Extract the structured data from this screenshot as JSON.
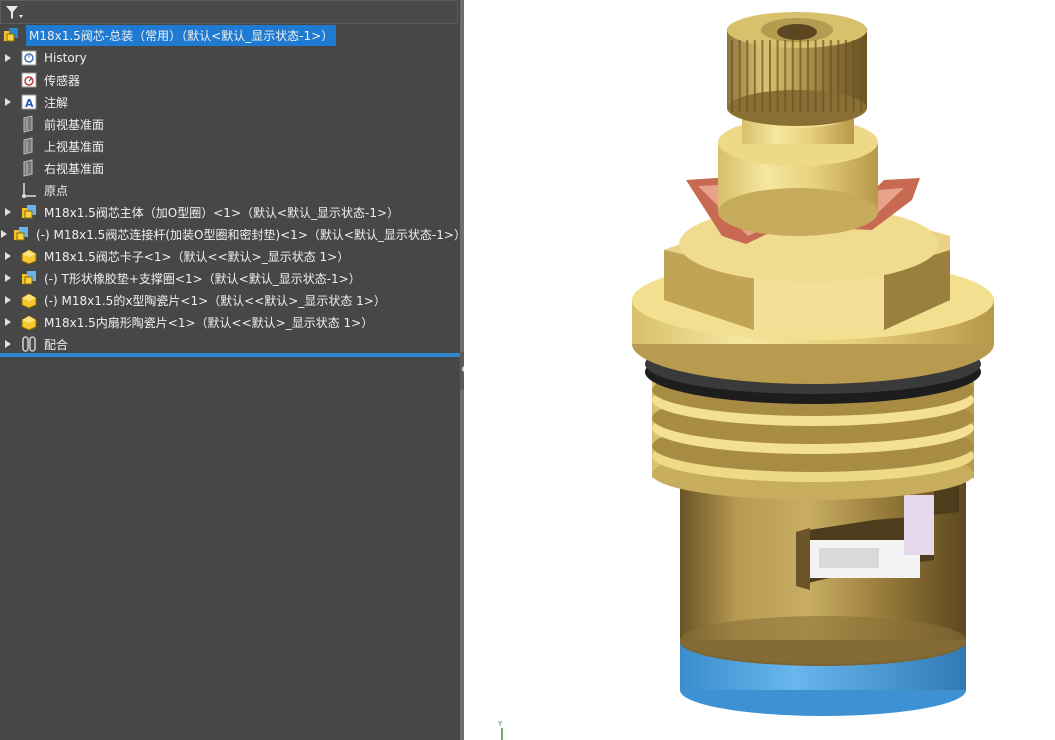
{
  "tree": {
    "filter_icon": "filter-icon",
    "root": {
      "label": "M18x1.5阀芯-总装（常用）（默认<默认_显示状态-1>）",
      "icon": "assembly-icon"
    },
    "items": [
      {
        "label": "History",
        "icon": "history-icon",
        "expandable": true
      },
      {
        "label": "传感器",
        "icon": "sensor-icon",
        "expandable": false
      },
      {
        "label": "注解",
        "icon": "annotation-icon",
        "expandable": true
      },
      {
        "label": "前视基准面",
        "icon": "plane-icon",
        "expandable": false
      },
      {
        "label": "上视基准面",
        "icon": "plane-icon",
        "expandable": false
      },
      {
        "label": "右视基准面",
        "icon": "plane-icon",
        "expandable": false
      },
      {
        "label": "原点",
        "icon": "origin-icon",
        "expandable": false
      },
      {
        "label": "M18x1.5阀芯主体（加O型圈）<1>（默认<默认_显示状态-1>）",
        "icon": "subassembly-icon",
        "expandable": true
      },
      {
        "label": "(-) M18x1.5阀芯连接杆(加装O型圈和密封垫)<1>（默认<默认_显示状态-1>）",
        "icon": "subassembly-icon",
        "expandable": true
      },
      {
        "label": "M18x1.5阀芯卡子<1>（默认<<默认>_显示状态 1>）",
        "icon": "part-icon",
        "expandable": true
      },
      {
        "label": "(-) T形状橡胶垫+支撑圈<1>（默认<默认_显示状态-1>）",
        "icon": "subassembly-icon",
        "expandable": true
      },
      {
        "label": "(-) M18x1.5的x型陶瓷片<1>（默认<<默认>_显示状态 1>）",
        "icon": "part-icon",
        "expandable": true
      },
      {
        "label": "M18x1.5内扇形陶瓷片<1>（默认<<默认>_显示状态 1>）",
        "icon": "part-icon",
        "expandable": true
      },
      {
        "label": "配合",
        "icon": "mates-icon",
        "expandable": true
      }
    ]
  },
  "graphics": {
    "model": "valve-cartridge-3d-model",
    "triad_label": "Y",
    "colors": {
      "brass_light": "#f2df8e",
      "brass_mid": "#c9ad5c",
      "brass_dark": "#7a6330",
      "copper": "#c86a52",
      "blue_ring": "#4fa3e2",
      "black_ring": "#222222"
    }
  }
}
